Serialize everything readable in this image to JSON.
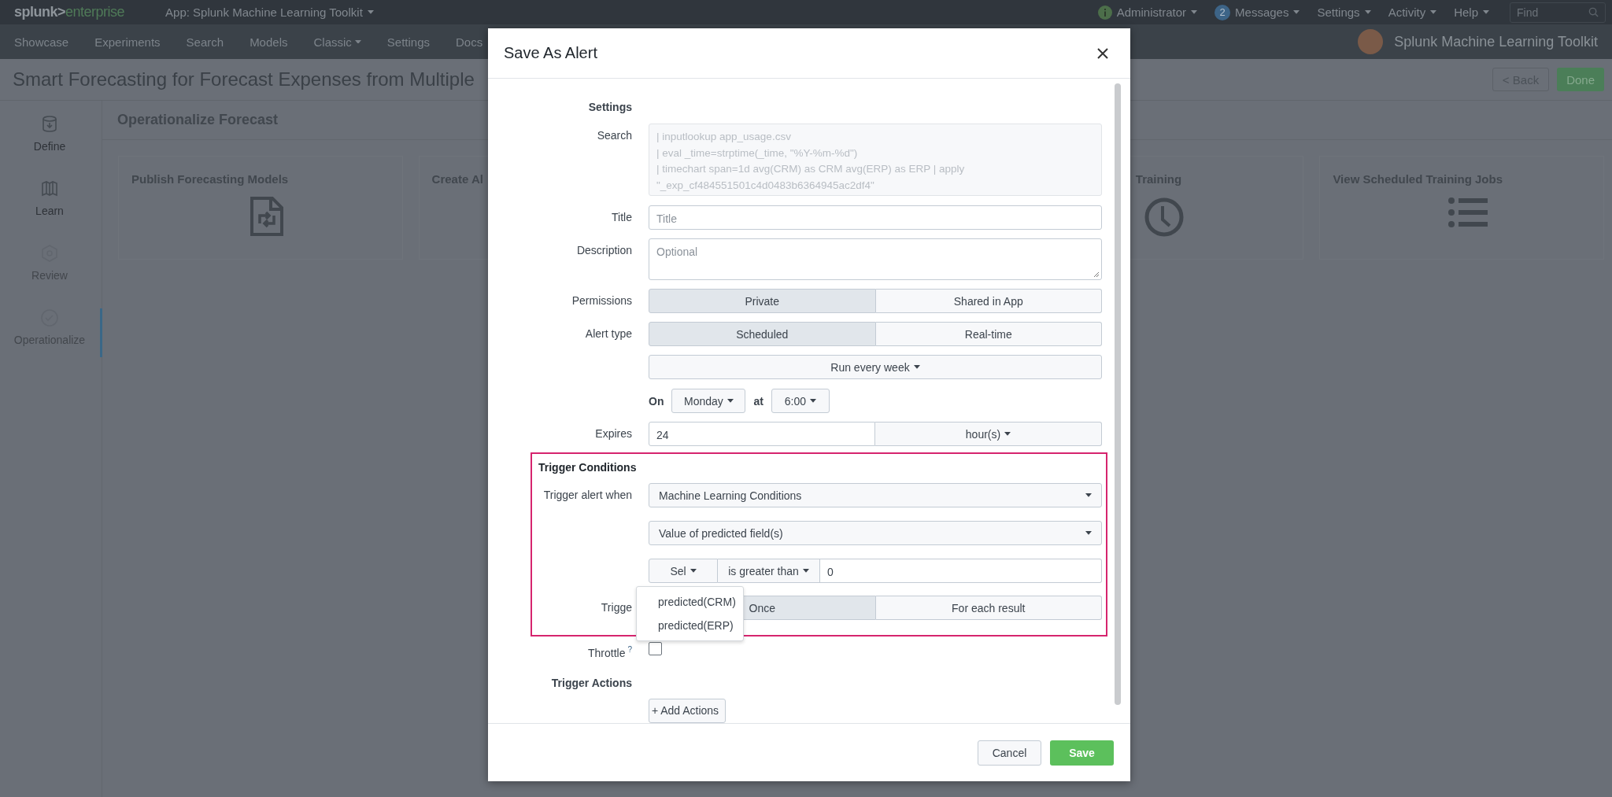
{
  "top_bar": {
    "logo": {
      "brand": "splunk>",
      "product": "enterprise"
    },
    "app_menu": "App: Splunk Machine Learning Toolkit",
    "menus": [
      {
        "kind": "info",
        "label": "Administrator"
      },
      {
        "kind": "count",
        "badge": "2",
        "label": "Messages"
      },
      {
        "kind": "plain",
        "label": "Settings"
      },
      {
        "kind": "plain",
        "label": "Activity"
      },
      {
        "kind": "plain",
        "label": "Help"
      }
    ],
    "search": {
      "placeholder": "Find"
    }
  },
  "app_bar": {
    "nav": [
      {
        "kind": "link",
        "label": "Showcase"
      },
      {
        "kind": "link",
        "label": "Experiments"
      },
      {
        "kind": "link",
        "label": "Search"
      },
      {
        "kind": "link",
        "label": "Models"
      },
      {
        "kind": "menu",
        "label": "Classic"
      },
      {
        "kind": "link",
        "label": "Settings"
      },
      {
        "kind": "external",
        "label": "Docs"
      }
    ],
    "app_title": "Splunk Machine Learning Toolkit"
  },
  "page": {
    "title": "Smart Forecasting for Forecast Expenses from Multiple",
    "buttons": [
      {
        "kind": "secondary",
        "label": "< Back"
      },
      {
        "kind": "primary",
        "label": "Done"
      }
    ]
  },
  "steps": [
    {
      "label": "Define",
      "selected": false,
      "dimmed": false
    },
    {
      "label": "Learn",
      "selected": false,
      "dimmed": false
    },
    {
      "label": "Review",
      "selected": false,
      "dimmed": true
    },
    {
      "label": "Operationalize",
      "selected": true,
      "dimmed": true
    }
  ],
  "section": {
    "title": "Operationalize Forecast",
    "cards": [
      {
        "title": "Publish Forecasting Models"
      },
      {
        "title": "Create Al"
      },
      {
        "title": "Training"
      },
      {
        "title": "View Scheduled Training Jobs"
      }
    ]
  },
  "modal": {
    "title": "Save As Alert",
    "rows": [
      {
        "kind": "heading",
        "label": "Settings"
      },
      {
        "kind": "code",
        "label": "Search",
        "lines": [
          "| inputlookup app_usage.csv",
          "| eval _time=strptime(_time, \"%Y-%m-%d\")",
          "| timechart span=1d avg(CRM) as CRM avg(ERP) as ERP | apply",
          "\"_exp_cf484551501c4d0483b6364945ac2df4\""
        ]
      },
      {
        "kind": "text",
        "label": "Title",
        "placeholder": "Title"
      },
      {
        "kind": "textarea",
        "label": "Description",
        "placeholder": "Optional"
      },
      {
        "kind": "toggle",
        "label": "Permissions",
        "options": [
          {
            "label": "Private",
            "selected": true
          },
          {
            "label": "Shared in App",
            "selected": false
          }
        ]
      },
      {
        "kind": "toggle",
        "label": "Alert type",
        "options": [
          {
            "label": "Scheduled",
            "selected": true
          },
          {
            "label": "Real-time",
            "selected": false
          }
        ]
      },
      {
        "kind": "menu",
        "value": "Run every week"
      },
      {
        "kind": "schedule",
        "on": "On",
        "day": "Monday",
        "at": "at",
        "time": "6:00"
      },
      {
        "kind": "expires",
        "label": "Expires",
        "value": "24",
        "unit": "hour(s)"
      }
    ],
    "trigger_conditions": {
      "heading": "Trigger Conditions",
      "rows": [
        {
          "kind": "select",
          "label": "Trigger alert when",
          "value": "Machine Learning Conditions"
        },
        {
          "kind": "select",
          "value": "Value of predicted field(s)"
        },
        {
          "kind": "condition",
          "field": "Sel",
          "operator": "is greater than",
          "value": "0"
        },
        {
          "kind": "toggle",
          "label": "Trigge",
          "options": [
            {
              "label": "Once",
              "selected": true
            },
            {
              "label": "For each result",
              "selected": false
            }
          ]
        }
      ],
      "popup": {
        "items": [
          "predicted(CRM)",
          "predicted(ERP)"
        ]
      }
    },
    "throttle": {
      "label": "Throttle",
      "help": "?",
      "checked": false
    },
    "trigger_actions": {
      "heading": "Trigger Actions",
      "button": "+ Add Actions"
    },
    "footer": {
      "buttons": [
        {
          "kind": "secondary",
          "label": "Cancel"
        },
        {
          "kind": "primary",
          "label": "Save"
        }
      ]
    }
  }
}
